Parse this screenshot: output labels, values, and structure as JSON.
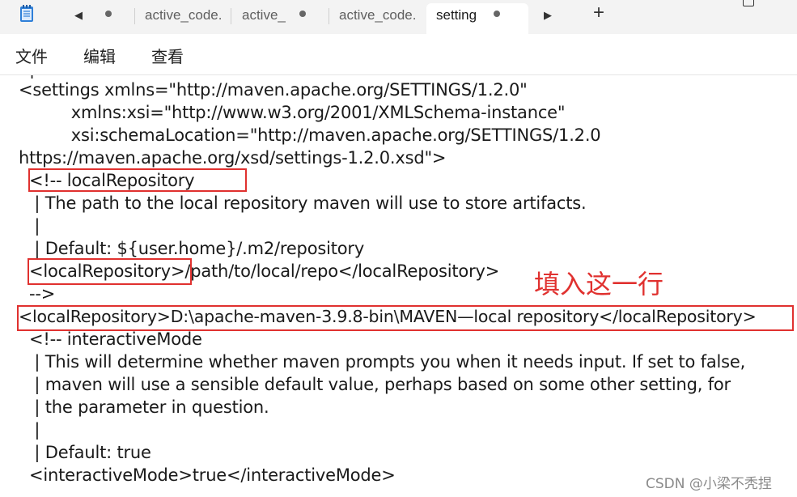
{
  "tabs": [
    {
      "label": "active_code.",
      "active": false
    },
    {
      "label": "active_",
      "active": false
    },
    {
      "label": "active_code.",
      "active": false
    },
    {
      "label": "setting",
      "active": true
    }
  ],
  "tab_controls": {
    "scroll_left": "◀",
    "scroll_right": "▶",
    "new_tab": "+"
  },
  "menu": [
    "文件",
    "编辑",
    "查看"
  ],
  "editor_lines": [
    "<settings xmlns=\"http://maven.apache.org/SETTINGS/1.2.0\"",
    "          xmlns:xsi=\"http://www.w3.org/2001/XMLSchema-instance\"",
    "          xsi:schemaLocation=\"http://maven.apache.org/SETTINGS/1.2.0",
    "https://maven.apache.org/xsd/settings-1.2.0.xsd\">",
    "  <!-- localRepository",
    "   | The path to the local repository maven will use to store artifacts.",
    "   |",
    "   | Default: ${user.home}/.m2/repository",
    "  <localRepository>/path/to/local/repo</localRepository>",
    "  -->",
    "<localRepository>D:\\apache-maven-3.9.8-bin\\MAVEN—local repository</localRepository>",
    "  <!-- interactiveMode",
    "   | This will determine whether maven prompts you when it needs input. If set to false,",
    "   | maven will use a sensible default value, perhaps based on some other setting, for",
    "   | the parameter in question.",
    "   |",
    "   | Default: true",
    "  <interactiveMode>true</interactiveMode>"
  ],
  "annotation": "填入这一行",
  "watermark": "CSDN @小梁不秃捏",
  "colors": {
    "highlight": "#e0312f",
    "tabbar": "#f3f3f3",
    "text": "#1a1a1a"
  }
}
